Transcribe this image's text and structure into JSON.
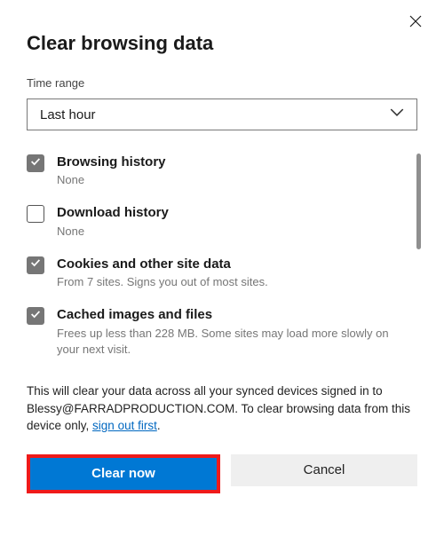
{
  "title": "Clear browsing data",
  "timeRange": {
    "label": "Time range",
    "selected": "Last hour"
  },
  "options": [
    {
      "checked": true,
      "title": "Browsing history",
      "sub": "None"
    },
    {
      "checked": false,
      "title": "Download history",
      "sub": "None"
    },
    {
      "checked": true,
      "title": "Cookies and other site data",
      "sub": "From 7 sites. Signs you out of most sites."
    },
    {
      "checked": true,
      "title": "Cached images and files",
      "sub": "Frees up less than 228 MB. Some sites may load more slowly on your next visit."
    }
  ],
  "note": {
    "pre": "This will clear your data across all your synced devices signed in to Blessy@FARRADPRODUCTION.COM. To clear browsing data from this device only, ",
    "link": "sign out first",
    "post": "."
  },
  "buttons": {
    "primary": "Clear now",
    "secondary": "Cancel"
  }
}
